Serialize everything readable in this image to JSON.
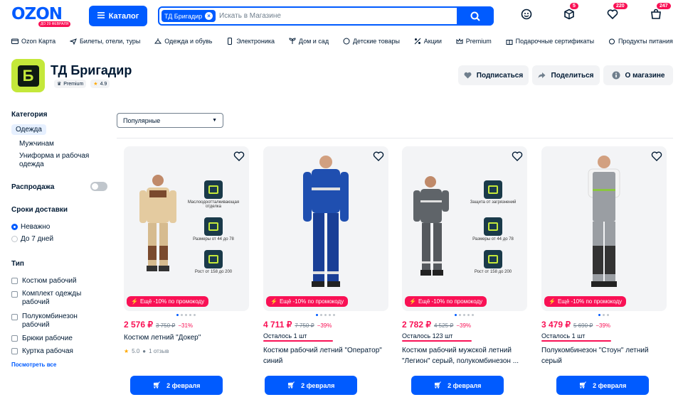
{
  "header": {
    "logo": "OZON",
    "logo_sub": "ДО 29 ФЕВРАЛЯ",
    "catalog_label": "Каталог",
    "search_chip": "ТД Бригадир",
    "search_placeholder": "Искать в Магазине",
    "favorites_count": "220",
    "cart_count": "247",
    "orders_count": "5"
  },
  "nav": [
    "Ozon Карта",
    "Билеты, отели, туры",
    "Одежда и обувь",
    "Электроника",
    "Дом и сад",
    "Детские товары",
    "Акции",
    "Premium",
    "Подарочные сертификаты",
    "Продукты питания"
  ],
  "brand": {
    "name": "ТД Бригадир",
    "logo_letter": "Б",
    "badge": "Premium",
    "rating": "4.9",
    "subscribe": "Подписаться",
    "share": "Поделиться",
    "about": "О магазине"
  },
  "sidebar": {
    "category_title": "Категория",
    "category_selected": "Одежда",
    "category_sub1": "Мужчинам",
    "category_sub2": "Униформа и рабочая одежда",
    "sale_title": "Распродажа",
    "delivery_title": "Сроки доставки",
    "delivery_opt1": "Неважно",
    "delivery_opt2": "До 7 дней",
    "type_title": "Тип",
    "types": [
      "Костюм рабочий",
      "Комплект одежды рабочий",
      "Полукомбинезон рабочий",
      "Брюки рабочие",
      "Куртка рабочая"
    ],
    "see_all": "Посмотреть все"
  },
  "sort": {
    "value": "Популярные"
  },
  "products": [
    {
      "price": "2 576 ₽",
      "old": "3 750 ₽",
      "disc": "−31%",
      "title": "Костюм летний \"Докер\"",
      "stock": "",
      "rating": "5.0",
      "reviews": "1 отзыв",
      "promo": "Ещё -10% по промокоду",
      "delivery": "2 февраля",
      "features": [
        "Маслоодоотталкивающая отделка",
        "Размеры от 44 до 78",
        "Рост от 158 до 200"
      ]
    },
    {
      "price": "4 711 ₽",
      "old": "7 750 ₽",
      "disc": "−39%",
      "title": "Костюм рабочий летний \"Оператор\" синий",
      "stock": "Осталось 1 шт",
      "promo": "Ещё -10% по промокоду",
      "delivery": "2 февраля"
    },
    {
      "price": "2 782 ₽",
      "old": "4 525 ₽",
      "disc": "−39%",
      "title": "Костюм рабочий мужской летний \"Легион\" серый, полукомбинезон ...",
      "stock": "Осталось 123 шт",
      "promo": "Ещё -10% по промокоду",
      "delivery": "2 февраля",
      "features": [
        "Защита от загрязнений",
        "Размеры от 44 до 78",
        "Рост от 158 до 200"
      ]
    },
    {
      "price": "3 479 ₽",
      "old": "5 690 ₽",
      "disc": "−39%",
      "title": "Полукомбинезон \"Стоун\" летний серый",
      "stock": "Осталось 1 шт",
      "promo": "Ещё -10% по промокоду",
      "delivery": "2 февраля"
    }
  ],
  "colors": {
    "accent": "#005bff",
    "sale": "#f91155",
    "brand_green": "#c4e83a"
  }
}
